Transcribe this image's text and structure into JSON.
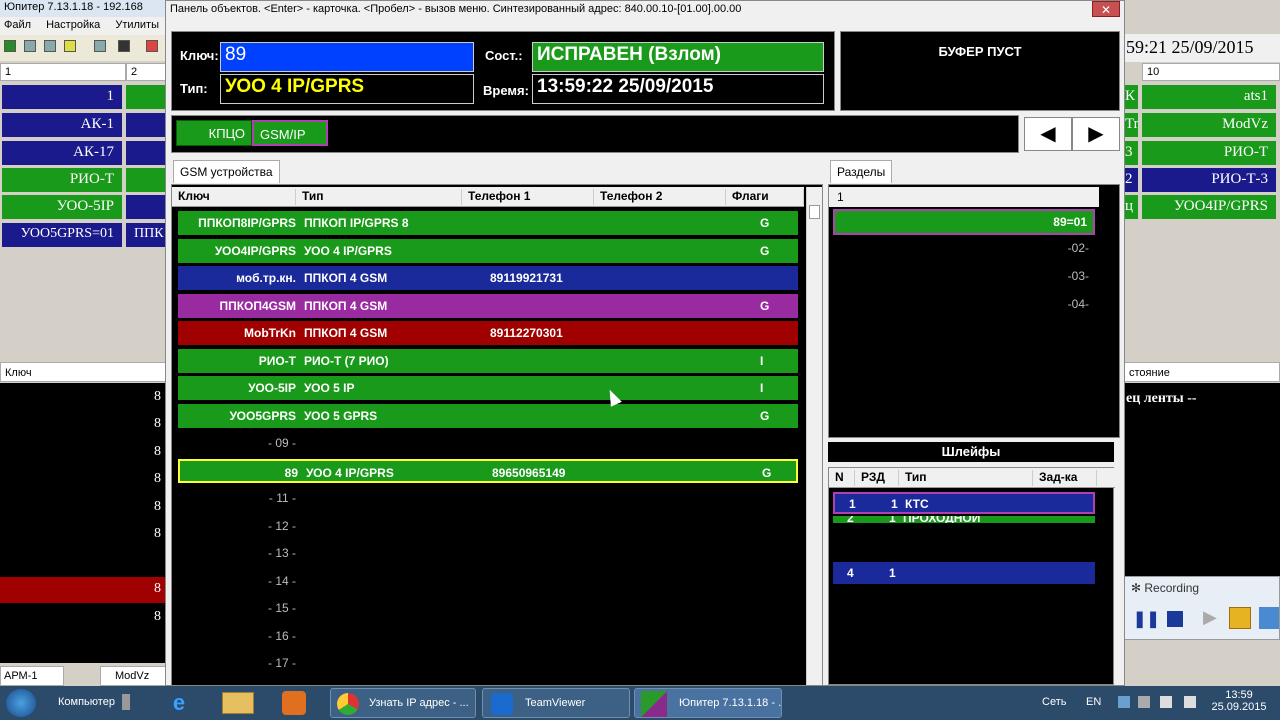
{
  "bg_app": {
    "title": "Юпитер 7.13.1.18 - 192.168",
    "menu": [
      "Файл",
      "Настройка",
      "Утилиты"
    ],
    "col1": "1",
    "col2": "2",
    "left_cells": [
      {
        "text": "1",
        "color": "blue"
      },
      {
        "text": "АК-1",
        "color": "blue"
      },
      {
        "text": "АК-17",
        "color": "blue"
      },
      {
        "text": "РИО-Т",
        "color": "green"
      },
      {
        "text": "УОО-5IP",
        "color": "green"
      },
      {
        "text": "УОО5GPRS=01",
        "color": "blue"
      }
    ],
    "left_cells2": [
      "ППК"
    ],
    "key_header": "Ключ",
    "left_nums": [
      "8",
      "8",
      "8",
      "8",
      "8",
      "8",
      "8",
      "8"
    ],
    "bottom_left": "АРМ-1",
    "bottom_mid": "ModVz",
    "right_time": "59:21 25/09/2015",
    "right_col": "10",
    "right_cells": [
      {
        "prefix": "К",
        "text": "ats1",
        "color": "green"
      },
      {
        "prefix": "Tr",
        "text": "ModVz",
        "color": "green"
      },
      {
        "prefix": "3",
        "text": "РИО-Т",
        "color": "green"
      },
      {
        "prefix": "2",
        "text": "РИО-Т-3",
        "color": "blue"
      },
      {
        "prefix": "ц",
        "text": "УОО4IP/GPRS",
        "color": "green"
      }
    ],
    "right_status_hdr": "стояние",
    "right_status_text": "ец ленты --"
  },
  "window": {
    "title": "Панель объектов. <Enter> - карточка. <Пробел> - вызов меню. Синтезированный адрес: 840.00.10-[01.00].00.00",
    "close": "✕",
    "key_label": "Ключ:",
    "key_value": "89",
    "type_label": "Тип:",
    "type_value": "УОО 4 IP/GPRS",
    "state_label": "Сост.:",
    "state_value": "ИСПРАВЕН (Взлом)",
    "time_label": "Время:",
    "time_value": "13:59:22 25/09/2015",
    "buffer": "БУФЕР ПУСТ",
    "btn1": "КПЦО",
    "btn2": "GSM/IP",
    "prev": "◀",
    "next": "▶"
  },
  "gsm": {
    "tab": "GSM устройства",
    "headers": [
      "Ключ",
      "Тип",
      "Телефон 1",
      "Телефон 2",
      "Флаги"
    ],
    "rows": [
      {
        "key": "ППКОП8IP/GPRS",
        "type": "ППКОП IP/GPRS 8",
        "phone": "",
        "flag": "G",
        "color": "#1a9a1a"
      },
      {
        "key": "УОО4IP/GPRS",
        "type": "УОО 4 IP/GPRS",
        "phone": "",
        "flag": "G",
        "color": "#1a9a1a"
      },
      {
        "key": "моб.тр.кн.",
        "type": "ППКОП 4 GSM",
        "phone": "89119921731",
        "flag": "",
        "color": "#1a2a9a"
      },
      {
        "key": "ППКОП4GSM",
        "type": "ППКОП 4 GSM",
        "phone": "",
        "flag": "G",
        "color": "#9a2aa0"
      },
      {
        "key": "MobTrKn",
        "type": "ППКОП 4 GSM",
        "phone": "89112270301",
        "flag": "",
        "color": "#a00000"
      },
      {
        "key": "РИО-Т",
        "type": "РИО-Т (7 РИО)",
        "phone": "",
        "flag": "I",
        "color": "#1a9a1a"
      },
      {
        "key": "УОО-5IP",
        "type": "УОО 5 IP",
        "phone": "",
        "flag": "I",
        "color": "#1a9a1a"
      },
      {
        "key": "УОО5GPRS",
        "type": "УОО 5 GPRS",
        "phone": "",
        "flag": "G",
        "color": "#1a9a1a"
      },
      {
        "key": "- 09 -",
        "type": "",
        "phone": "",
        "flag": "",
        "color": ""
      },
      {
        "key": "89",
        "type": "УОО 4 IP/GPRS",
        "phone": "89650965149",
        "flag": "G",
        "color": "#1a9a1a"
      },
      {
        "key": "- 11 -",
        "type": "",
        "phone": "",
        "flag": "",
        "color": ""
      },
      {
        "key": "- 12 -",
        "type": "",
        "phone": "",
        "flag": "",
        "color": ""
      },
      {
        "key": "- 13 -",
        "type": "",
        "phone": "",
        "flag": "",
        "color": ""
      },
      {
        "key": "- 14 -",
        "type": "",
        "phone": "",
        "flag": "",
        "color": ""
      },
      {
        "key": "- 15 -",
        "type": "",
        "phone": "",
        "flag": "",
        "color": ""
      },
      {
        "key": "- 16 -",
        "type": "",
        "phone": "",
        "flag": "",
        "color": ""
      },
      {
        "key": "- 17 -",
        "type": "",
        "phone": "",
        "flag": "",
        "color": ""
      }
    ]
  },
  "sections": {
    "tab": "Разделы",
    "header": "1",
    "items": [
      "89=01",
      "-02-",
      "-03-",
      "-04-"
    ]
  },
  "loops": {
    "title": "Шлейфы",
    "headers": [
      "N",
      "РЗД",
      "Тип",
      "Зад-ка"
    ],
    "rows": [
      {
        "n": "1",
        "rzd": "1",
        "type": "КТС",
        "color": "#1a2a9a"
      },
      {
        "n": "2",
        "rzd": "1",
        "type": "ПРОХОДНОЙ",
        "color": "#1a9a1a"
      },
      {
        "n": "4",
        "rzd": "1",
        "type": "",
        "color": "#1a2a9a"
      }
    ]
  },
  "recording": {
    "title": "Recording"
  },
  "taskbar": {
    "computer": "Компьютер",
    "chrome": "Узнать IP адрес - ...",
    "teamviewer": "TeamViewer",
    "jupiter": "Юпитер 7.13.1.18 - ...",
    "network": "Сеть",
    "lang": "EN",
    "time": "13:59",
    "date": "25.09.2015"
  }
}
